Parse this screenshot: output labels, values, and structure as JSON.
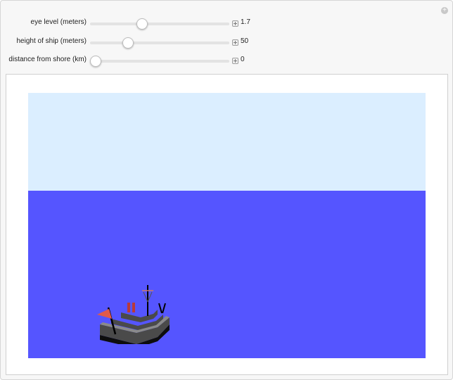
{
  "controls": [
    {
      "label": "eye level (meters)",
      "value": "1.7",
      "fraction": 0.36
    },
    {
      "label": "height of ship (meters)",
      "value": "50",
      "fraction": 0.25
    },
    {
      "label": "distance from shore (km)",
      "value": "0",
      "fraction": 0.0
    }
  ],
  "corner_icon": "plus-circle-icon",
  "scene": {
    "sky_color": "#dbeeff",
    "sea_color": "#5555ff",
    "ship_hull_color": "#4a4a4a",
    "flag_color": "#e05a4a",
    "funnel_color": "#b83a3a"
  }
}
